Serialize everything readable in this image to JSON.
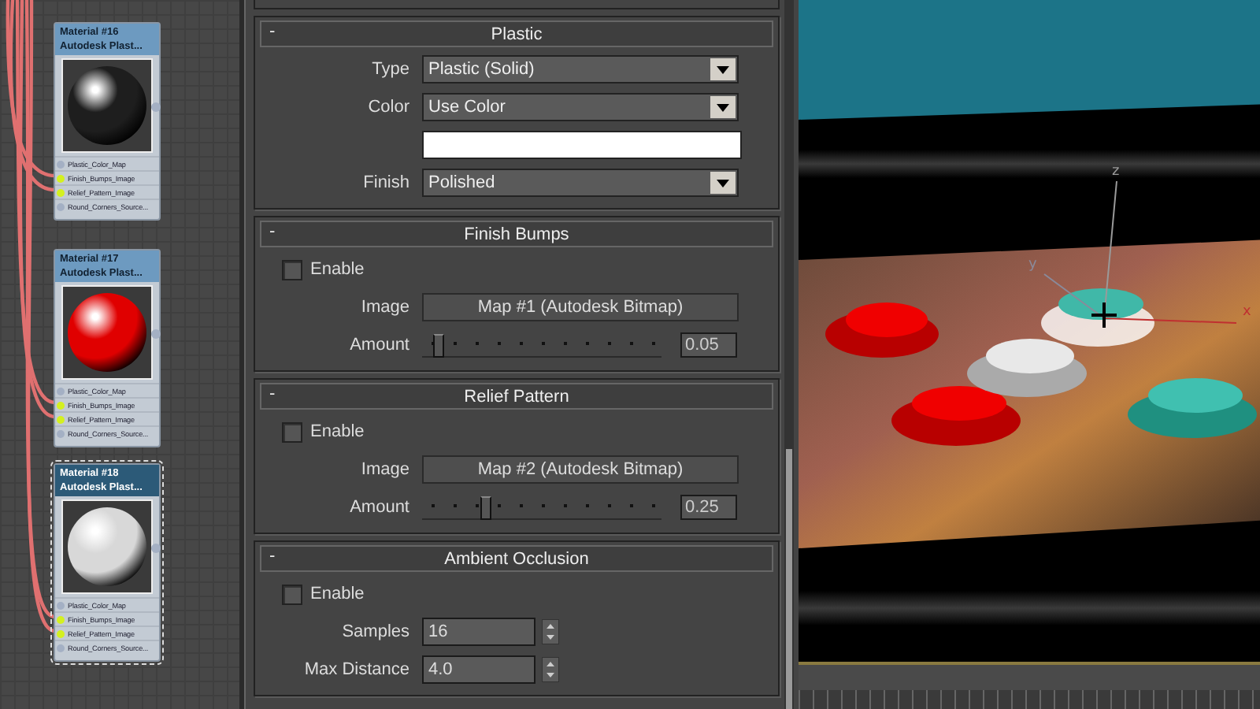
{
  "node_editor": {
    "nodes": [
      {
        "title": "Material #16",
        "subtitle": "Autodesk Plast...",
        "color": "#1e1e1e",
        "selected": false,
        "ports": [
          {
            "label": "Plastic_Color_Map",
            "connected": false
          },
          {
            "label": "Finish_Bumps_Image",
            "connected": true
          },
          {
            "label": "Relief_Pattern_Image",
            "connected": true
          },
          {
            "label": "Round_Corners_Source...",
            "connected": false
          }
        ]
      },
      {
        "title": "Material #17",
        "subtitle": "Autodesk Plast...",
        "color": "#e00000",
        "selected": false,
        "ports": [
          {
            "label": "Plastic_Color_Map",
            "connected": false
          },
          {
            "label": "Finish_Bumps_Image",
            "connected": true
          },
          {
            "label": "Relief_Pattern_Image",
            "connected": true
          },
          {
            "label": "Round_Corners_Source...",
            "connected": false
          }
        ]
      },
      {
        "title": "Material #18",
        "subtitle": "Autodesk Plast...",
        "color": "#d8d8d8",
        "selected": true,
        "ports": [
          {
            "label": "Plastic_Color_Map",
            "connected": false
          },
          {
            "label": "Finish_Bumps_Image",
            "connected": true
          },
          {
            "label": "Relief_Pattern_Image",
            "connected": true
          },
          {
            "label": "Round_Corners_Source...",
            "connected": false
          }
        ]
      }
    ]
  },
  "panel": {
    "sections": [
      {
        "title": "Plastic",
        "toggle": "-",
        "rows": [
          {
            "kind": "dropdown",
            "label": "Type",
            "value": "Plastic (Solid)"
          },
          {
            "kind": "dropdown",
            "label": "Color",
            "value": "Use Color"
          },
          {
            "kind": "swatch",
            "color": "#ffffff"
          },
          {
            "kind": "dropdown",
            "label": "Finish",
            "value": "Polished"
          }
        ]
      },
      {
        "title": "Finish Bumps",
        "toggle": "-",
        "rows": [
          {
            "kind": "checkbox",
            "label": "Enable",
            "checked": false
          },
          {
            "kind": "map",
            "label": "Image",
            "value": "Map #1 (Autodesk Bitmap)"
          },
          {
            "kind": "slider",
            "label": "Amount",
            "level": 0.05,
            "value": "0.05"
          }
        ]
      },
      {
        "title": "Relief Pattern",
        "toggle": "-",
        "rows": [
          {
            "kind": "checkbox",
            "label": "Enable",
            "checked": false
          },
          {
            "kind": "map",
            "label": "Image",
            "value": "Map #2 (Autodesk Bitmap)"
          },
          {
            "kind": "slider",
            "label": "Amount",
            "level": 0.25,
            "value": "0.25"
          }
        ]
      },
      {
        "title": "Ambient Occlusion",
        "toggle": "-",
        "rows": [
          {
            "kind": "checkbox",
            "label": "Enable",
            "checked": false
          },
          {
            "kind": "spinner",
            "label": "Samples",
            "value": "16"
          },
          {
            "kind": "spinner",
            "label": "Max Distance",
            "value": "4.0"
          }
        ]
      }
    ]
  },
  "viewport": {
    "axes": [
      {
        "label": "z"
      },
      {
        "label": "y"
      },
      {
        "label": "x"
      }
    ]
  }
}
